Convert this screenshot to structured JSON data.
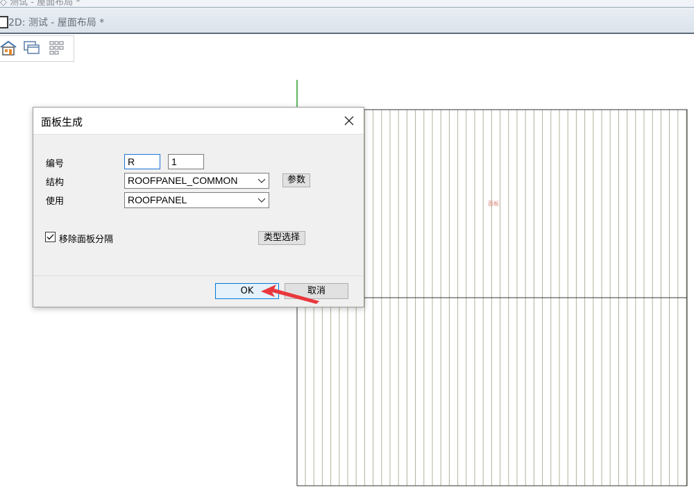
{
  "window": {
    "outer_title": "◇ 测试 - 屋面布局 *",
    "tab_title": "2D: 测试 - 屋面布局 *"
  },
  "toolbar": {
    "icons": [
      "home-icon",
      "window-icon",
      "grid-icon"
    ]
  },
  "dialog": {
    "title": "面板生成",
    "fields": {
      "number_label": "编号",
      "number_prefix": "R",
      "number_value": "1",
      "structure_label": "结构",
      "structure_value": "ROOFPANEL_COMMON",
      "usage_label": "使用",
      "usage_value": "ROOFPANEL"
    },
    "params_button": "参数",
    "remove_gap_checkbox": {
      "label": "移除面板分隔",
      "checked": true
    },
    "type_select_button": "类型选择",
    "ok_button": "OK",
    "cancel_button": "取消"
  },
  "canvas": {
    "small_label": "面板"
  },
  "colors": {
    "annotation_arrow": "#e8383d",
    "axis_line": "#2aa02a",
    "panel_lines": "#b0b09a"
  }
}
